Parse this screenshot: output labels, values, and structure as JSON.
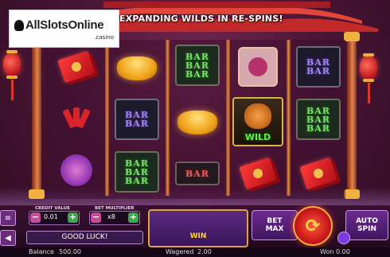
{
  "banner": {
    "text": "EXPANDING WILDS IN RE-SPINS!"
  },
  "logo": {
    "brand": "AllSlotsOnline",
    "tld": ".casino"
  },
  "reels": [
    {
      "symbols": [
        "red-envelope",
        "firecrackers",
        "purple-knot"
      ]
    },
    {
      "symbols": [
        "gold-ingot",
        "bar-purple",
        "bar-green"
      ],
      "bar_text": [
        "BAR",
        "BAR",
        "BAR"
      ]
    },
    {
      "symbols": [
        "bar-green",
        "gold-ingot",
        "bar-red"
      ]
    },
    {
      "symbols": [
        "paw-coin",
        "tiger-wild",
        "red-envelope"
      ],
      "wild_label": "WILD"
    },
    {
      "symbols": [
        "bar-purple",
        "bar-green",
        "red-envelope"
      ]
    }
  ],
  "controls": {
    "credit_value_label": "CREDIT VALUE",
    "credit_value": "0.01",
    "bet_multiplier_label": "BET MULTIPLIER",
    "bet_multiplier": "x8",
    "message": "GOOD LUCK!",
    "win_label": "WIN",
    "bet_max_label": "BET MAX",
    "auto_spin_label": "AUTO SPIN",
    "spin_icon": "refresh-arrows-icon",
    "menu_icon": "menu-icon",
    "sound_icon": "speaker-icon"
  },
  "status": {
    "balance_label": "Balance",
    "balance": "500.00",
    "wagered_label": "Wagered",
    "wagered": "2.00",
    "won_label": "Won",
    "won": "0.00"
  }
}
